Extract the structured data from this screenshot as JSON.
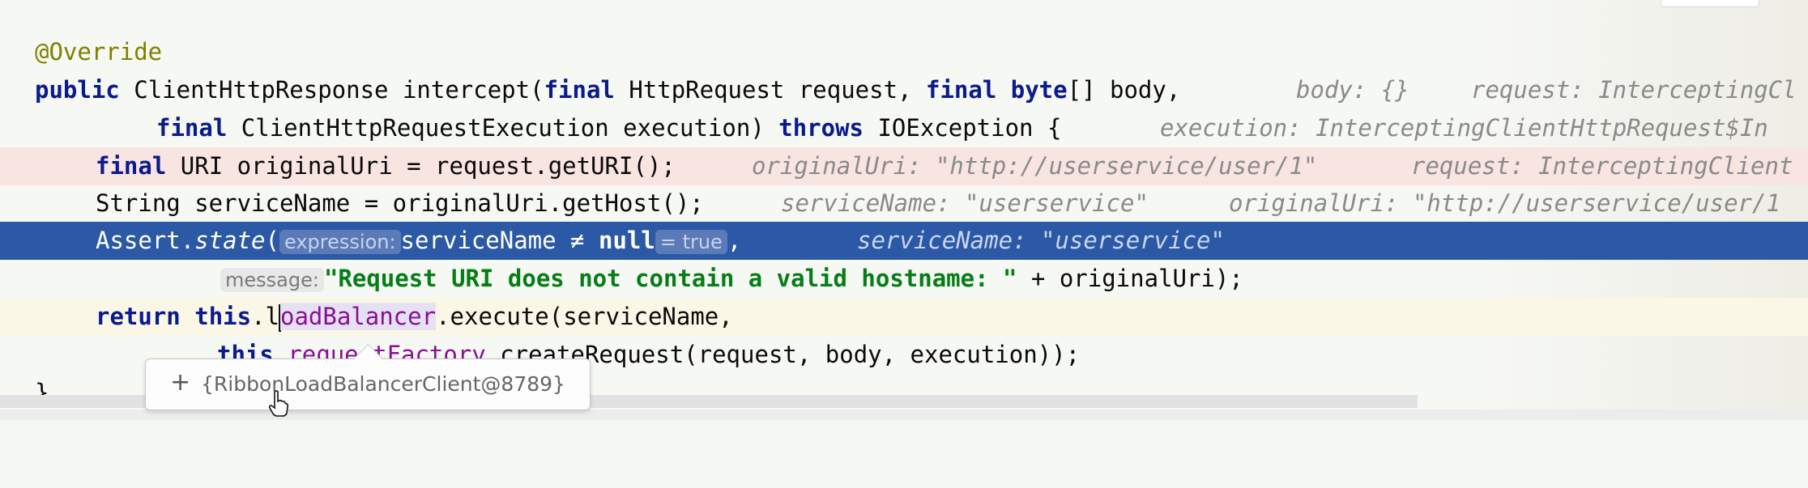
{
  "code": {
    "annotation": "@Override",
    "sig1": {
      "kw_public": "public",
      "ret": "ClientHttpResponse intercept(",
      "kw_final1": "final",
      "arg1": " HttpRequest request, ",
      "kw_final2": "final",
      "kw_byte": "byte",
      "arg2": "[] body,",
      "hint1": "body: {}",
      "hint2": "request: InterceptingCl"
    },
    "sig2": {
      "kw_final": "final",
      "arg": " ClientHttpRequestExecution execution) ",
      "kw_throws": "throws",
      "rest": " IOException {",
      "hint": "execution: InterceptingClientHttpRequest$In"
    },
    "uri_line": {
      "kw_final": "final",
      "text": " URI originalUri = request.getURI();",
      "hint1": "originalUri: \"http://userservice/user/1\"",
      "hint2": "request: InterceptingClient"
    },
    "name_line": {
      "text": "String serviceName = originalUri.getHost();",
      "hint1": "serviceName: \"userservice\"",
      "hint2": "originalUri: \"http://userservice/user/1"
    },
    "assert_line": {
      "prefix": "Assert.",
      "method": "state",
      "paren": "(",
      "inlay_label": "expression:",
      "expr": "serviceName ≠ ",
      "kw_null": "null",
      "inlay_value": "= true",
      "comma": ",",
      "hint": "serviceName: \"userservice\""
    },
    "message_line": {
      "inlay_label": "message:",
      "string": "\"Request URI does not contain a valid hostname: \"",
      "rest": " + originalUri);"
    },
    "return_line": {
      "kw_return": "return",
      "kw_this": "this",
      "dot": ".l",
      "field": "oadBalancer",
      "rest": ".execute(serviceName,"
    },
    "factory_line": {
      "kw_this": "this",
      "field": "requestFactory",
      "rest": ".createRequest(request, body, execution));"
    },
    "closing": "}"
  },
  "tooltip": {
    "expand": "+",
    "value": "{RibbonLoadBalancerClient@8789}"
  }
}
